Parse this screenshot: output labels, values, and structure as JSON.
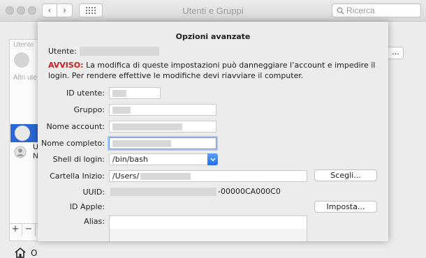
{
  "window": {
    "title": "Utenti e Gruppi",
    "search_placeholder": "Ricerca"
  },
  "background": {
    "sidebar_label_current": "Utente",
    "sidebar_label_other": "Altri ute",
    "user_row_line1": "U",
    "user_row_line2": "N",
    "login_options_label": "O",
    "add_label": "+",
    "remove_label": "−",
    "right_button_label": "..."
  },
  "sheet": {
    "title": "Opzioni avanzate",
    "user_label": "Utente:",
    "warning_prefix": "AVVISO:",
    "warning_text": "La modifica di queste impostazioni può danneggiare l’account e impedire il login. Per rendere effettive le modifiche devi riavviare il computer.",
    "fields": {
      "user_id_label": "ID utente:",
      "group_label": "Gruppo:",
      "account_name_label": "Nome account:",
      "full_name_label": "Nome completo:",
      "login_shell_label": "Shell di login:",
      "login_shell_value": "/bin/bash",
      "home_folder_label": "Cartella Inizio:",
      "home_folder_value": "/Users/",
      "uuid_label": "UUID:",
      "uuid_suffix": "-00000CA000C0",
      "apple_id_label": "ID Apple:",
      "alias_label": "Alias:"
    },
    "buttons": {
      "choose": "Scegli...",
      "set": "Imposta..."
    }
  }
}
